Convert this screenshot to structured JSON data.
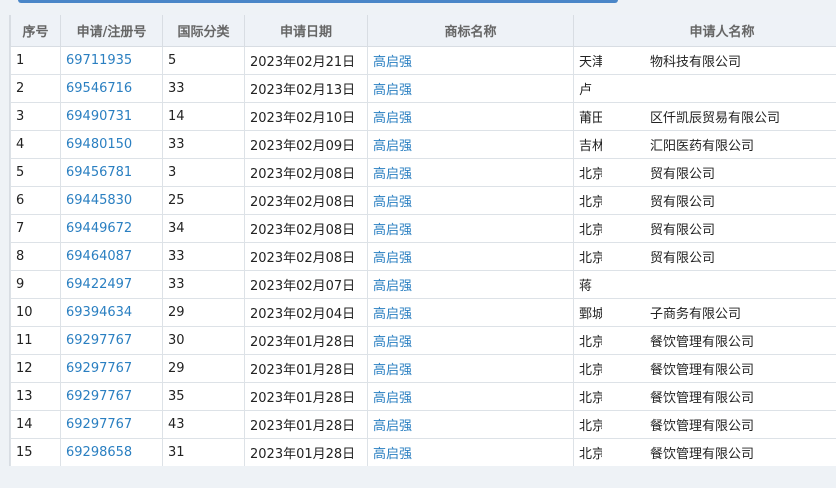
{
  "table": {
    "headers": [
      "序号",
      "申请/注册号",
      "国际分类",
      "申请日期",
      "商标名称",
      "申请人名称"
    ],
    "rows": [
      {
        "idx": "1",
        "reg": "69711935",
        "cls": "5",
        "date": "2023年02月21日",
        "mark": "高启强",
        "app_pre": "天津",
        "app_post": "物科技有限公司"
      },
      {
        "idx": "2",
        "reg": "69546716",
        "cls": "33",
        "date": "2023年02月13日",
        "mark": "高启强",
        "app_pre": "卢",
        "app_post": ""
      },
      {
        "idx": "3",
        "reg": "69490731",
        "cls": "14",
        "date": "2023年02月10日",
        "mark": "高启强",
        "app_pre": "莆田",
        "app_post": "区仟凯辰贸易有限公司"
      },
      {
        "idx": "4",
        "reg": "69480150",
        "cls": "33",
        "date": "2023年02月09日",
        "mark": "高启强",
        "app_pre": "吉林",
        "app_post": "汇阳医药有限公司"
      },
      {
        "idx": "5",
        "reg": "69456781",
        "cls": "3",
        "date": "2023年02月08日",
        "mark": "高启强",
        "app_pre": "北京",
        "app_post": "贸有限公司"
      },
      {
        "idx": "6",
        "reg": "69445830",
        "cls": "25",
        "date": "2023年02月08日",
        "mark": "高启强",
        "app_pre": "北京",
        "app_post": "贸有限公司"
      },
      {
        "idx": "7",
        "reg": "69449672",
        "cls": "34",
        "date": "2023年02月08日",
        "mark": "高启强",
        "app_pre": "北京",
        "app_post": "贸有限公司"
      },
      {
        "idx": "8",
        "reg": "69464087",
        "cls": "33",
        "date": "2023年02月08日",
        "mark": "高启强",
        "app_pre": "北京",
        "app_post": "贸有限公司"
      },
      {
        "idx": "9",
        "reg": "69422497",
        "cls": "33",
        "date": "2023年02月07日",
        "mark": "高启强",
        "app_pre": "蒋",
        "app_post": ""
      },
      {
        "idx": "10",
        "reg": "69394634",
        "cls": "29",
        "date": "2023年02月04日",
        "mark": "高启强",
        "app_pre": "鄄城",
        "app_post": "子商务有限公司"
      },
      {
        "idx": "11",
        "reg": "69297767",
        "cls": "30",
        "date": "2023年01月28日",
        "mark": "高启强",
        "app_pre": "北京",
        "app_post": "餐饮管理有限公司"
      },
      {
        "idx": "12",
        "reg": "69297767",
        "cls": "29",
        "date": "2023年01月28日",
        "mark": "高启强",
        "app_pre": "北京",
        "app_post": "餐饮管理有限公司"
      },
      {
        "idx": "13",
        "reg": "69297767",
        "cls": "35",
        "date": "2023年01月28日",
        "mark": "高启强",
        "app_pre": "北京",
        "app_post": "餐饮管理有限公司"
      },
      {
        "idx": "14",
        "reg": "69297767",
        "cls": "43",
        "date": "2023年01月28日",
        "mark": "高启强",
        "app_pre": "北京",
        "app_post": "餐饮管理有限公司"
      },
      {
        "idx": "15",
        "reg": "69298658",
        "cls": "31",
        "date": "2023年01月28日",
        "mark": "高启强",
        "app_pre": "北京",
        "app_post": "餐饮管理有限公司"
      }
    ]
  }
}
